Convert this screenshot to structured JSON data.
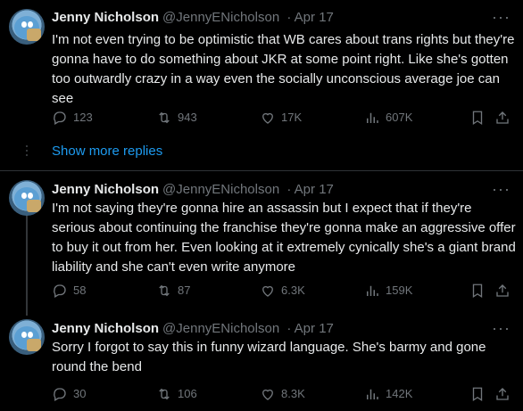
{
  "tweets": [
    {
      "name": "Jenny Nicholson",
      "handle": "@JennyENicholson",
      "date": "· Apr 17",
      "text": "I'm not even trying to be optimistic that WB cares about trans rights but they're gonna have to do something about JKR at some point right. Like she's gotten too outwardly crazy in a way even the socially unconscious average joe can see",
      "replies": "123",
      "reposts": "943",
      "likes": "17K",
      "views": "607K"
    },
    {
      "name": "Jenny Nicholson",
      "handle": "@JennyENicholson",
      "date": "· Apr 17",
      "text": "I'm not saying they're gonna hire an assassin but I expect that if they're serious about continuing the franchise they're gonna make an aggressive offer to buy it out from her. Even looking at it extremely cynically she's a giant brand liability and she can't even write anymore",
      "replies": "58",
      "reposts": "87",
      "likes": "6.3K",
      "views": "159K"
    },
    {
      "name": "Jenny Nicholson",
      "handle": "@JennyENicholson",
      "date": "· Apr 17",
      "text": "Sorry I forgot to say this in funny wizard language. She's barmy and gone round the bend",
      "replies": "30",
      "reposts": "106",
      "likes": "8.3K",
      "views": "142K"
    }
  ],
  "show_more_label": "Show more replies",
  "more_glyph": "···",
  "icons": [
    "reply-icon",
    "repost-icon",
    "like-icon",
    "views-icon",
    "bookmark-icon",
    "share-icon"
  ],
  "colors": {
    "background": "#000000",
    "text": "#e7e9ea",
    "muted": "#71767b",
    "link": "#1d9bf0"
  }
}
